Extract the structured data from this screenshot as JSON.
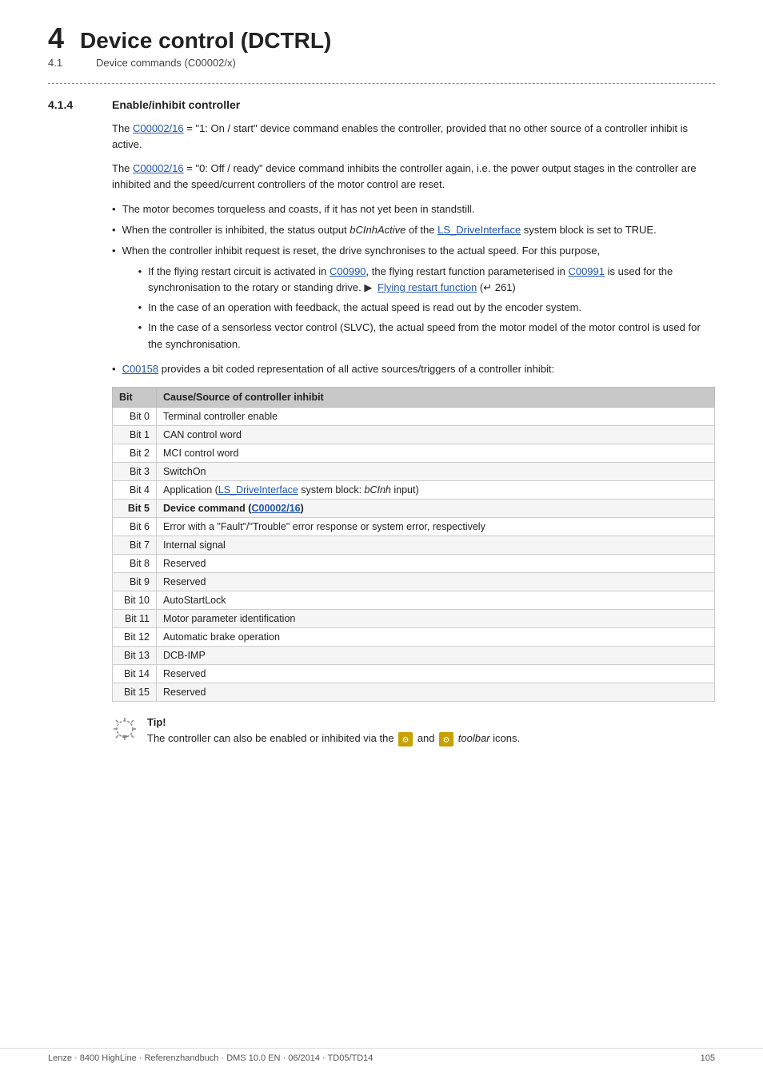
{
  "header": {
    "chapter_number": "4",
    "chapter_title": "Device control (DCTRL)",
    "subchapter_number": "4.1",
    "subchapter_title": "Device commands (C00002/x)"
  },
  "section": {
    "number": "4.1.4",
    "title": "Enable/inhibit controller"
  },
  "paragraphs": {
    "p1_pre": "The ",
    "p1_link1": "C00002/16",
    "p1_post": " = \"1: On / start\" device command enables the controller, provided that no other source of a controller inhibit is active.",
    "p2_pre": "The ",
    "p2_link1": "C00002/16",
    "p2_post": " = \"0: Off / ready\" device command inhibits the controller again, i.e. the power output stages in the controller are inhibited and the speed/current controllers of the motor control are reset."
  },
  "bullets": [
    {
      "text": "The motor becomes torqueless and coasts, if it has not yet been in standstill."
    },
    {
      "text_pre": "When the controller is inhibited, the status output ",
      "text_italic": "bCInhActive",
      "text_mid": " of the ",
      "text_link": "LS_DriveInterface",
      "text_post": " system block is set to TRUE."
    },
    {
      "text_pre": "When the controller inhibit request is reset, the drive synchronises to the actual speed. For this purpose,",
      "subbullets": [
        {
          "text_pre": "If the flying restart circuit is activated in ",
          "text_link1": "C00990",
          "text_mid": ", the flying restart function parameterised in ",
          "text_link2": "C00991",
          "text_mid2": " is used for the synchronisation to the rotary or standing drive. ",
          "text_arrow": "▶",
          "text_link3": "Flying restart function",
          "text_post": " (↵ 261)"
        },
        {
          "text": "In the case of an operation with feedback, the actual speed is read out by the encoder system."
        },
        {
          "text": "In the case of a sensorless vector control (SLVC), the actual speed from the motor model of the motor control is used for the synchronisation."
        }
      ]
    },
    {
      "text_pre": "",
      "text_link": "C00158",
      "text_post": " provides a bit coded representation of all active sources/triggers of a controller inhibit:"
    }
  ],
  "table": {
    "headers": [
      "Bit",
      "Cause/Source of controller inhibit"
    ],
    "rows": [
      {
        "bit": "Bit 0",
        "cause": "Terminal controller enable",
        "highlighted": false
      },
      {
        "bit": "Bit 1",
        "cause": "CAN control word",
        "highlighted": false
      },
      {
        "bit": "Bit 2",
        "cause": "MCI control word",
        "highlighted": false
      },
      {
        "bit": "Bit 3",
        "cause": "SwitchOn",
        "highlighted": false
      },
      {
        "bit": "Bit 4",
        "cause_pre": "Application (",
        "cause_link": "LS_DriveInterface",
        "cause_mid": " system block: ",
        "cause_italic": "bCInh",
        "cause_post": " input)",
        "highlighted": false
      },
      {
        "bit": "Bit 5",
        "cause_pre": "Device command (",
        "cause_link": "C00002/16",
        "cause_post": ")",
        "highlighted": true
      },
      {
        "bit": "Bit 6",
        "cause": "Error with a \"Fault\"/\"Trouble\" error response or system error, respectively",
        "highlighted": false
      },
      {
        "bit": "Bit 7",
        "cause": "Internal signal",
        "highlighted": false
      },
      {
        "bit": "Bit 8",
        "cause": "Reserved",
        "highlighted": false
      },
      {
        "bit": "Bit 9",
        "cause": "Reserved",
        "highlighted": false
      },
      {
        "bit": "Bit 10",
        "cause": "AutoStartLock",
        "highlighted": false
      },
      {
        "bit": "Bit 11",
        "cause": "Motor parameter identification",
        "highlighted": false
      },
      {
        "bit": "Bit 12",
        "cause": "Automatic brake operation",
        "highlighted": false
      },
      {
        "bit": "Bit 13",
        "cause": "DCB-IMP",
        "highlighted": false
      },
      {
        "bit": "Bit 14",
        "cause": "Reserved",
        "highlighted": false
      },
      {
        "bit": "Bit 15",
        "cause": "Reserved",
        "highlighted": false
      }
    ]
  },
  "tip": {
    "label": "Tip!",
    "text_pre": "The controller can also be enabled or inhibited via the ",
    "text_and": "and",
    "text_post": " toolbar icons."
  },
  "footer": {
    "left": "Lenze · 8400 HighLine · Referenzhandbuch · DMS 10.0 EN · 06/2014 · TD05/TD14",
    "right": "105"
  }
}
